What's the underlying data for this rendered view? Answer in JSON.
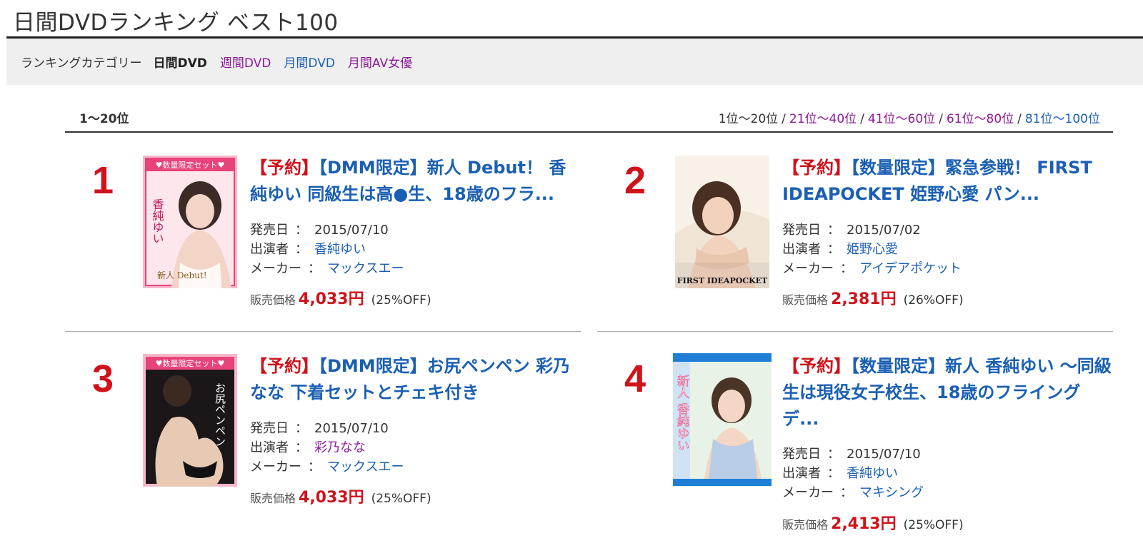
{
  "page_title": "日間DVDランキング ベスト100",
  "category_bar": {
    "label": "ランキングカテゴリー",
    "current": "日間DVD",
    "links": [
      {
        "label": "週間DVD",
        "visited": true
      },
      {
        "label": "月間DVD",
        "visited": false
      },
      {
        "label": "月間AV女優",
        "visited": true
      }
    ]
  },
  "range_heading": "1〜20位",
  "range_nav": {
    "current": "1位〜20位",
    "separator": "/",
    "links": [
      {
        "label": "21位〜40位",
        "visited": true
      },
      {
        "label": "41位〜60位",
        "visited": true
      },
      {
        "label": "61位〜80位",
        "visited": true
      },
      {
        "label": "81位〜100位",
        "visited": false
      }
    ]
  },
  "labels": {
    "release": "発売日",
    "performer": "出演者",
    "maker": "メーカー",
    "colon": "：",
    "price": "販売価格"
  },
  "items": [
    {
      "rank": "1",
      "reserve": "【予約】",
      "title": "【DMM限定】新人 Debut！ 香純ゆい 同級生は高●生、18歳のフラ...",
      "release_date": "2015/07/10",
      "performer": "香純ゆい",
      "performer_visited": false,
      "maker": "マックスエー",
      "price": "4,033円",
      "discount": "(25%OFF)",
      "cover": {
        "band_text": "♥数量限定セット♥",
        "side_text": "香純ゆい",
        "badge": "新人 Debut!",
        "bg": "#f6b7c8",
        "band": "#e8437a"
      }
    },
    {
      "rank": "2",
      "reserve": "【予約】",
      "title": "【数量限定】緊急参戦！ FIRST IDEAPOCKET 姫野心愛 パン...",
      "release_date": "2015/07/02",
      "performer": "姫野心愛",
      "performer_visited": false,
      "maker": "アイデアポケット",
      "price": "2,381円",
      "discount": "(26%OFF)",
      "cover": {
        "caption": "FIRST IDEAPOCKET",
        "bg": "#efe4d6"
      }
    },
    {
      "rank": "3",
      "reserve": "【予約】",
      "title": "【DMM限定】お尻ペンペン 彩乃なな 下着セットとチェキ付き",
      "release_date": "2015/07/10",
      "performer": "彩乃なな",
      "performer_visited": true,
      "maker": "マックスエー",
      "price": "4,033円",
      "discount": "(25%OFF)",
      "cover": {
        "band_text": "♥数量限定セット♥",
        "side_text": "お尻ペンペン",
        "bg": "#1b1618",
        "band": "#e8437a"
      }
    },
    {
      "rank": "4",
      "reserve": "【予約】",
      "title": "【数量限定】新人 香純ゆい 〜同級生は現役女子校生、18歳のフライングデ...",
      "release_date": "2015/07/10",
      "performer": "香純ゆい",
      "performer_visited": false,
      "maker": "マキシング",
      "price": "2,413円",
      "discount": "(25%OFF)",
      "cover": {
        "side_text": "新人 香純ゆい",
        "bg": "#cfe3f4",
        "band": "#1f7fd6"
      }
    }
  ]
}
